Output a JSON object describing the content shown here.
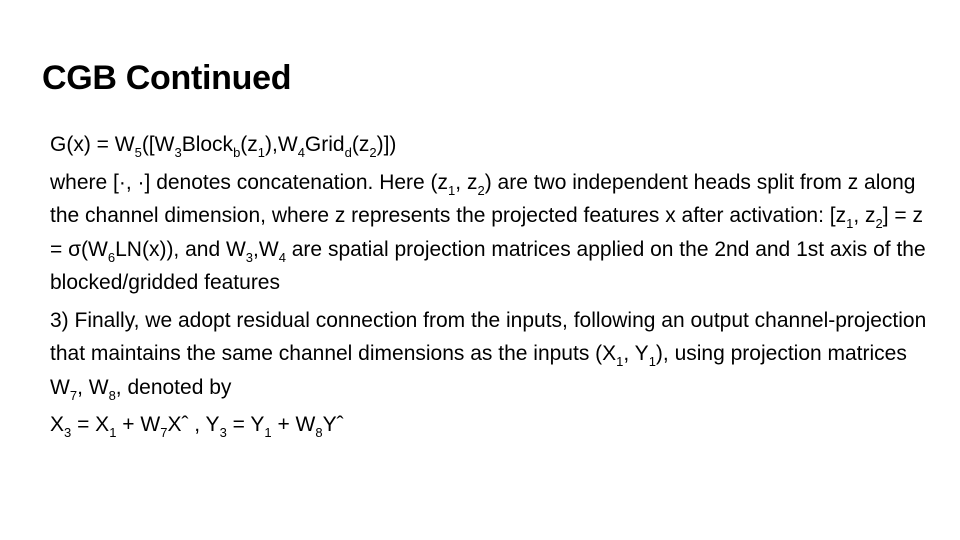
{
  "slide": {
    "title": "CGB Continued",
    "eq1": {
      "a": "G(x) = W",
      "s5": "5",
      "b": "([W",
      "s3": "3",
      "c": "Block",
      "sb": "b",
      "d": "(z",
      "s1": "1",
      "e": "),W",
      "s4": "4",
      "f": "Grid",
      "sd": "d",
      "g": "(z",
      "s2": "2",
      "h": ")])"
    },
    "p1": {
      "a": "where [·, ·] denotes concatenation. Here (z",
      "s1": "1",
      "b": ", z",
      "s2": "2",
      "c": ") are two independent heads split from z along the channel dimension, where z represents the projected features x after activation: [z",
      "s3": "1",
      "d": ", z",
      "s4": "2",
      "e": "] = z = σ(W",
      "s5": "6",
      "f": "LN(x)), and W",
      "s6": "3",
      "g": ",W",
      "s7": "4",
      "h": " are spatial projection matrices applied on the 2nd and 1st axis of the blocked/gridded features"
    },
    "p2": {
      "a": "3) Finally, we adopt residual connection from the inputs, following an output channel-projection that maintains the same channel dimensions as the inputs (X",
      "s1": "1",
      "b": ", Y",
      "s2": "1",
      "c": "), using projection matrices W",
      "s3": "7",
      "d": ", W",
      "s4": "8",
      "e": ", denoted by"
    },
    "eq2": {
      "a": "X",
      "s1": "3",
      "b": " = X",
      "s2": "1",
      "c": " + W",
      "s3": "7",
      "d": "Xˆ , Y",
      "s4": "3",
      "e": " = Y",
      "s5": "1",
      "f": " + W",
      "s6": "8",
      "g": "Yˆ"
    }
  }
}
